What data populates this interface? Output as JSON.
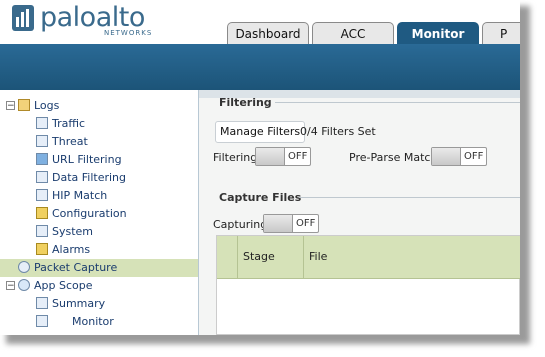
{
  "brand": {
    "name": "paloalto",
    "subtitle": "NETWORKS"
  },
  "tabs": [
    {
      "label": "Dashboard",
      "active": false
    },
    {
      "label": "ACC",
      "active": false
    },
    {
      "label": "Monitor",
      "active": true
    },
    {
      "label": "P",
      "active": false
    }
  ],
  "sidebar": {
    "items": [
      {
        "label": "Logs",
        "icon": "logs-folder-icon",
        "expander": "−"
      },
      {
        "label": "Traffic",
        "icon": "traffic-log-icon"
      },
      {
        "label": "Threat",
        "icon": "threat-log-icon"
      },
      {
        "label": "URL Filtering",
        "icon": "url-filtering-icon"
      },
      {
        "label": "Data Filtering",
        "icon": "data-filtering-icon"
      },
      {
        "label": "HIP Match",
        "icon": "hip-match-icon"
      },
      {
        "label": "Configuration",
        "icon": "configuration-icon"
      },
      {
        "label": "System",
        "icon": "system-icon"
      },
      {
        "label": "Alarms",
        "icon": "alarms-icon"
      },
      {
        "label": "Packet Capture",
        "icon": "packet-capture-icon",
        "selected": true
      },
      {
        "label": "App Scope",
        "icon": "app-scope-icon",
        "expander": "−"
      },
      {
        "label": "Summary",
        "icon": "summary-icon"
      },
      {
        "label": "Monitor",
        "icon": "change-monitor-icon"
      }
    ]
  },
  "filtering": {
    "heading": "Filtering",
    "manage_filters_label": "Manage Filters",
    "filters_set": "0/4 Filters Set",
    "filtering_label": "Filtering",
    "filtering_state": "OFF",
    "preparse_label": "Pre-Parse Match",
    "preparse_state": "OFF"
  },
  "capture_files": {
    "heading": "Capture Files",
    "capturing_label": "Capturing",
    "capturing_state": "OFF",
    "columns": [
      "Stage",
      "File"
    ]
  },
  "colors": {
    "accent": "#1f5a82",
    "selected_row": "#d6e2b8",
    "brand": "#3a6a8c"
  }
}
